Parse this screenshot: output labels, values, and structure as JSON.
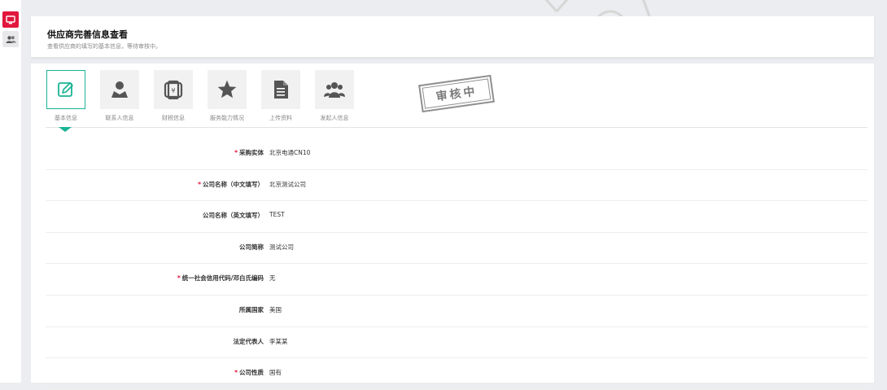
{
  "sidebar": {
    "items": [
      {
        "icon": "monitor-icon"
      },
      {
        "icon": "users-icon"
      }
    ]
  },
  "header": {
    "title": "供应商完善信息查看",
    "subtitle": "查看供应商的填写的基本信息，等待审核中。"
  },
  "tabs": [
    {
      "label": "基本信息",
      "icon": "edit-icon",
      "active": true
    },
    {
      "label": "联系人信息",
      "icon": "person-icon"
    },
    {
      "label": "财税信息",
      "icon": "wallet-icon"
    },
    {
      "label": "服务能力情况",
      "icon": "star-icon"
    },
    {
      "label": "上传资料",
      "icon": "document-icon"
    },
    {
      "label": "发起人信息",
      "icon": "group-icon"
    }
  ],
  "stamp": {
    "text": "审核中"
  },
  "form": {
    "rows": [
      {
        "label": "采购实体",
        "value": "北京电通CN10",
        "required": true
      },
      {
        "label": "公司名称（中文填写）",
        "value": "北京测试公司",
        "required": true
      },
      {
        "label": "公司名称（英文填写）",
        "value": "TEST",
        "required": false
      },
      {
        "label": "公司简称",
        "value": "测试公司",
        "required": false
      },
      {
        "label": "统一社会信用代码/邓白氏编码",
        "value": "无",
        "required": true
      },
      {
        "label": "所属国家",
        "value": "美国",
        "required": false
      },
      {
        "label": "法定代表人",
        "value": "李某某",
        "required": false
      },
      {
        "label": "公司性质",
        "value": "国有",
        "required": true
      }
    ]
  },
  "colors": {
    "accent": "#1ab394",
    "brand": "#e1173d",
    "required": "#e1173d"
  }
}
